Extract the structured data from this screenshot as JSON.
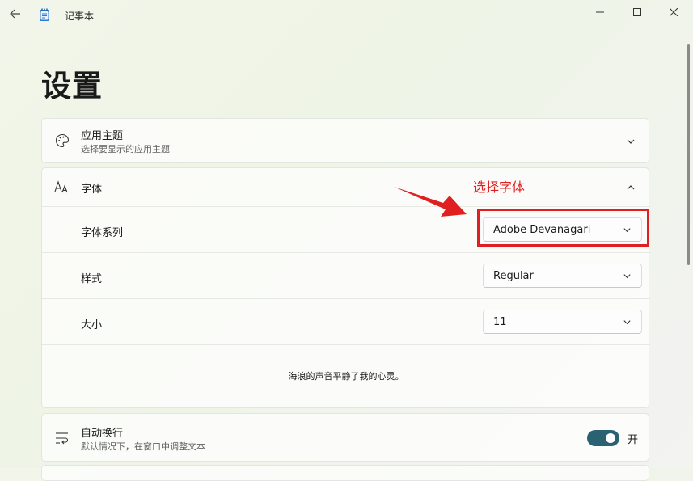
{
  "window": {
    "app_title": "记事本",
    "icons": {
      "back": "back-arrow-icon",
      "app": "notepad-icon",
      "minimize": "minimize-icon",
      "maximize": "maximize-icon",
      "close": "close-icon"
    }
  },
  "page": {
    "title": "设置"
  },
  "app_theme": {
    "title": "应用主题",
    "subtitle": "选择要显示的应用主题",
    "icon": "palette-icon"
  },
  "font": {
    "title": "字体",
    "icon": "font-icon",
    "family": {
      "label": "字体系列",
      "value": "Adobe Devanagari"
    },
    "style": {
      "label": "样式",
      "value": "Regular"
    },
    "size": {
      "label": "大小",
      "value": "11"
    },
    "preview": "海浪的声音平静了我的心灵。"
  },
  "annotation": {
    "text": "选择字体",
    "color": "#e02020"
  },
  "word_wrap": {
    "title": "自动换行",
    "subtitle": "默认情况下，在窗口中调整文本",
    "icon": "word-wrap-icon",
    "state_label": "开",
    "on": true
  },
  "colors": {
    "accent": "#2a6272",
    "annotation": "#e02020"
  }
}
